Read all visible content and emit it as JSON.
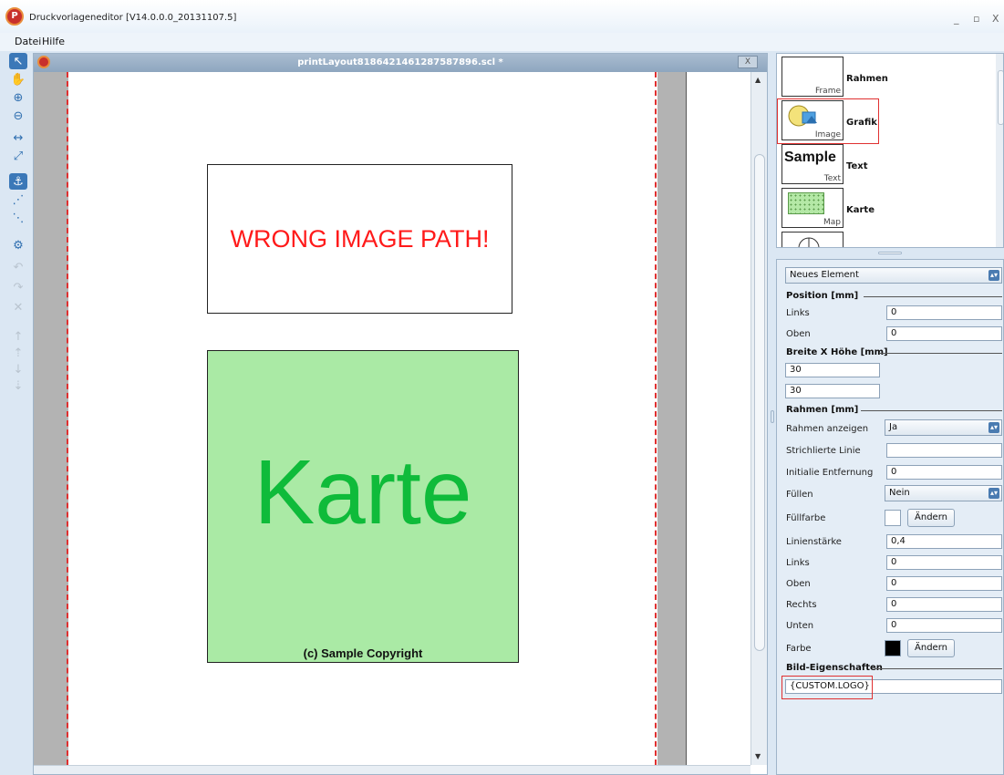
{
  "window": {
    "title": "Druckvorlageneditor [V14.0.0.0_20131107.5]",
    "logo_letter": "P",
    "minimize": "_",
    "restore": "▫",
    "close": "X"
  },
  "menu": {
    "file": "Datei",
    "help": "Hilfe"
  },
  "document": {
    "title": "printLayout8186421461287587896.scl *",
    "close_label": "X",
    "image_box_text": "WRONG IMAGE PATH!",
    "map_box_text": "Karte",
    "map_copyright": "(c) Sample Copyright"
  },
  "palette": {
    "items": [
      {
        "caption": "Frame",
        "label": "Rahmen"
      },
      {
        "caption": "Image",
        "label": "Grafik"
      },
      {
        "caption": "Text",
        "preview": "Sample",
        "label": "Text"
      },
      {
        "caption": "Map",
        "label": "Karte"
      }
    ]
  },
  "properties": {
    "element_select": "Neues Element",
    "position_header": "Position [mm]",
    "links_label": "Links",
    "links_value": "0",
    "oben_label": "Oben",
    "oben_value": "0",
    "size_header": "Breite X Höhe [mm]",
    "width_value": "30",
    "height_value": "30",
    "frame_header": "Rahmen [mm]",
    "show_frame_label": "Rahmen anzeigen",
    "show_frame_value": "Ja",
    "dashed_label": "Strichlierte Linie",
    "dashed_value": "",
    "initial_distance_label": "Initialie Entfernung",
    "initial_distance_value": "0",
    "fill_label": "Füllen",
    "fill_value": "Nein",
    "fill_color_label": "Füllfarbe",
    "fill_color": "#ffffff",
    "change_button": "Ändern",
    "line_width_label": "Linienstärke",
    "line_width_value": "0,4",
    "frame_links_label": "Links",
    "frame_links_value": "0",
    "frame_oben_label": "Oben",
    "frame_oben_value": "0",
    "frame_rechts_label": "Rechts",
    "frame_rechts_value": "0",
    "frame_unten_label": "Unten",
    "frame_unten_value": "0",
    "color_label": "Farbe",
    "color": "#000000",
    "image_props_header": "Bild-Eigenschaften",
    "image_path_value": "{CUSTOM.LOGO}"
  },
  "colors": {
    "error_text": "#ff1a1a",
    "map_fill": "#aaeaa5",
    "map_text": "#0fbb3a",
    "highlight": "#e03030"
  }
}
